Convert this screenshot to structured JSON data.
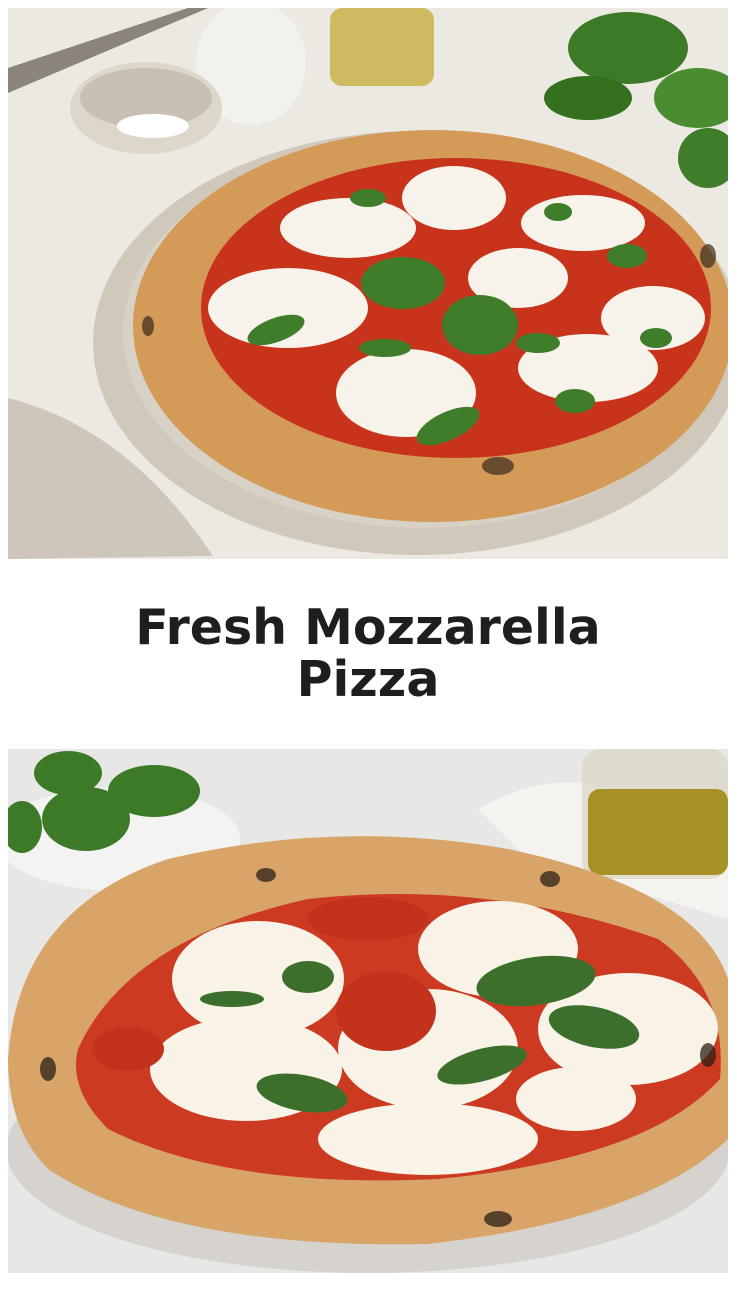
{
  "pin": {
    "title": "Fresh Mozzarella Pizza"
  },
  "images": {
    "top": {
      "subject": "margherita pizza with fresh mozzarella and basil on a stoneware plate"
    },
    "bottom": {
      "subject": "neapolitan pizza with melted mozzarella and basil leaves"
    }
  },
  "colors": {
    "crust": "#d49a58",
    "sauce": "#c8331c",
    "mozzarella": "#f7f3ea",
    "basil": "#3f7d2a",
    "title": "#1e1e1e"
  }
}
